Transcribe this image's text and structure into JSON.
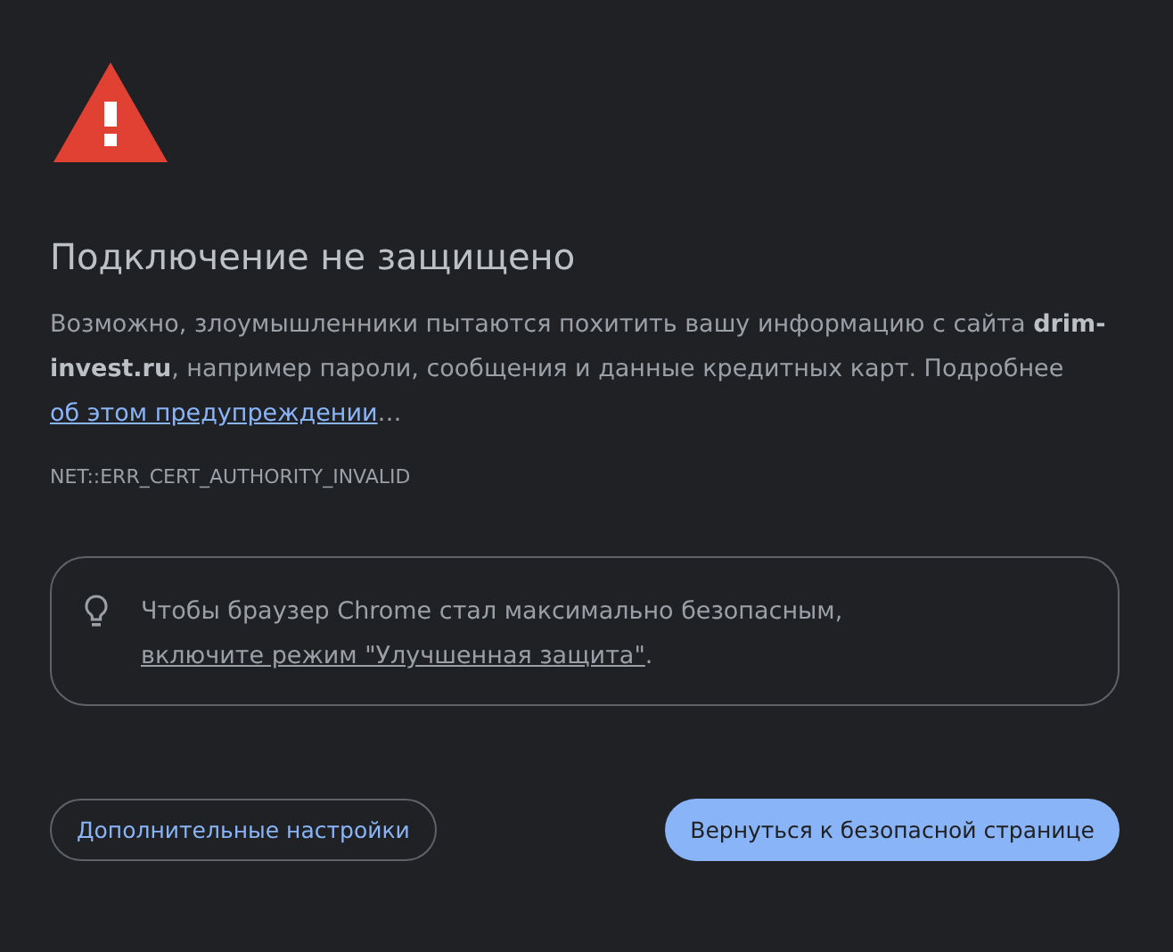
{
  "title": "Подключение не защищено",
  "description": {
    "text": "Возможно, злоумышленники пытаются похитить вашу информацию с сайта **drim-invest.ru**, например пароли, сообщения и данные кредитных карт. Подробнее",
    "link": "об этом предупреждении",
    "trailing": "…"
  },
  "error_code": "NET::ERR_CERT_AUTHORITY_INVALID",
  "hint": {
    "text": "Чтобы браузер Chrome стал максимально безопасным,",
    "link": "включите режим \"Улучшенная защита\"",
    "trailing": "."
  },
  "buttons": [
    {
      "label": "Дополнительные настройки",
      "kind": "secondary"
    },
    {
      "label": "Вернуться к безопасной странице",
      "kind": "primary"
    }
  ]
}
